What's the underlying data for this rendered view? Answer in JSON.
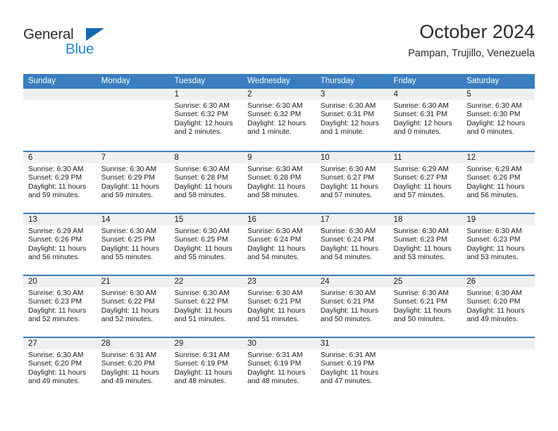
{
  "brand": {
    "line1": "General",
    "line2": "Blue",
    "triangle_icon": "triangle-icon",
    "color_dark": "#2b2b2b",
    "color_blue": "#1e87d6"
  },
  "header": {
    "title": "October 2024",
    "subtitle": "Pampan, Trujillo, Venezuela"
  },
  "colors": {
    "header_bar": "#3a7ebf",
    "daynum_strip": "#f0f0f0",
    "text": "#1a1a1a"
  },
  "weekdays": [
    "Sunday",
    "Monday",
    "Tuesday",
    "Wednesday",
    "Thursday",
    "Friday",
    "Saturday"
  ],
  "weeks": [
    [
      {
        "day": "",
        "lines": []
      },
      {
        "day": "",
        "lines": []
      },
      {
        "day": "1",
        "lines": [
          "Sunrise: 6:30 AM",
          "Sunset: 6:32 PM",
          "Daylight: 12 hours",
          "and 2 minutes."
        ]
      },
      {
        "day": "2",
        "lines": [
          "Sunrise: 6:30 AM",
          "Sunset: 6:32 PM",
          "Daylight: 12 hours",
          "and 1 minute."
        ]
      },
      {
        "day": "3",
        "lines": [
          "Sunrise: 6:30 AM",
          "Sunset: 6:31 PM",
          "Daylight: 12 hours",
          "and 1 minute."
        ]
      },
      {
        "day": "4",
        "lines": [
          "Sunrise: 6:30 AM",
          "Sunset: 6:31 PM",
          "Daylight: 12 hours",
          "and 0 minutes."
        ]
      },
      {
        "day": "5",
        "lines": [
          "Sunrise: 6:30 AM",
          "Sunset: 6:30 PM",
          "Daylight: 12 hours",
          "and 0 minutes."
        ]
      }
    ],
    [
      {
        "day": "6",
        "lines": [
          "Sunrise: 6:30 AM",
          "Sunset: 6:29 PM",
          "Daylight: 11 hours",
          "and 59 minutes."
        ]
      },
      {
        "day": "7",
        "lines": [
          "Sunrise: 6:30 AM",
          "Sunset: 6:29 PM",
          "Daylight: 11 hours",
          "and 59 minutes."
        ]
      },
      {
        "day": "8",
        "lines": [
          "Sunrise: 6:30 AM",
          "Sunset: 6:28 PM",
          "Daylight: 11 hours",
          "and 58 minutes."
        ]
      },
      {
        "day": "9",
        "lines": [
          "Sunrise: 6:30 AM",
          "Sunset: 6:28 PM",
          "Daylight: 11 hours",
          "and 58 minutes."
        ]
      },
      {
        "day": "10",
        "lines": [
          "Sunrise: 6:30 AM",
          "Sunset: 6:27 PM",
          "Daylight: 11 hours",
          "and 57 minutes."
        ]
      },
      {
        "day": "11",
        "lines": [
          "Sunrise: 6:29 AM",
          "Sunset: 6:27 PM",
          "Daylight: 11 hours",
          "and 57 minutes."
        ]
      },
      {
        "day": "12",
        "lines": [
          "Sunrise: 6:29 AM",
          "Sunset: 6:26 PM",
          "Daylight: 11 hours",
          "and 56 minutes."
        ]
      }
    ],
    [
      {
        "day": "13",
        "lines": [
          "Sunrise: 6:29 AM",
          "Sunset: 6:26 PM",
          "Daylight: 11 hours",
          "and 56 minutes."
        ]
      },
      {
        "day": "14",
        "lines": [
          "Sunrise: 6:30 AM",
          "Sunset: 6:25 PM",
          "Daylight: 11 hours",
          "and 55 minutes."
        ]
      },
      {
        "day": "15",
        "lines": [
          "Sunrise: 6:30 AM",
          "Sunset: 6:25 PM",
          "Daylight: 11 hours",
          "and 55 minutes."
        ]
      },
      {
        "day": "16",
        "lines": [
          "Sunrise: 6:30 AM",
          "Sunset: 6:24 PM",
          "Daylight: 11 hours",
          "and 54 minutes."
        ]
      },
      {
        "day": "17",
        "lines": [
          "Sunrise: 6:30 AM",
          "Sunset: 6:24 PM",
          "Daylight: 11 hours",
          "and 54 minutes."
        ]
      },
      {
        "day": "18",
        "lines": [
          "Sunrise: 6:30 AM",
          "Sunset: 6:23 PM",
          "Daylight: 11 hours",
          "and 53 minutes."
        ]
      },
      {
        "day": "19",
        "lines": [
          "Sunrise: 6:30 AM",
          "Sunset: 6:23 PM",
          "Daylight: 11 hours",
          "and 53 minutes."
        ]
      }
    ],
    [
      {
        "day": "20",
        "lines": [
          "Sunrise: 6:30 AM",
          "Sunset: 6:23 PM",
          "Daylight: 11 hours",
          "and 52 minutes."
        ]
      },
      {
        "day": "21",
        "lines": [
          "Sunrise: 6:30 AM",
          "Sunset: 6:22 PM",
          "Daylight: 11 hours",
          "and 52 minutes."
        ]
      },
      {
        "day": "22",
        "lines": [
          "Sunrise: 6:30 AM",
          "Sunset: 6:22 PM",
          "Daylight: 11 hours",
          "and 51 minutes."
        ]
      },
      {
        "day": "23",
        "lines": [
          "Sunrise: 6:30 AM",
          "Sunset: 6:21 PM",
          "Daylight: 11 hours",
          "and 51 minutes."
        ]
      },
      {
        "day": "24",
        "lines": [
          "Sunrise: 6:30 AM",
          "Sunset: 6:21 PM",
          "Daylight: 11 hours",
          "and 50 minutes."
        ]
      },
      {
        "day": "25",
        "lines": [
          "Sunrise: 6:30 AM",
          "Sunset: 6:21 PM",
          "Daylight: 11 hours",
          "and 50 minutes."
        ]
      },
      {
        "day": "26",
        "lines": [
          "Sunrise: 6:30 AM",
          "Sunset: 6:20 PM",
          "Daylight: 11 hours",
          "and 49 minutes."
        ]
      }
    ],
    [
      {
        "day": "27",
        "lines": [
          "Sunrise: 6:30 AM",
          "Sunset: 6:20 PM",
          "Daylight: 11 hours",
          "and 49 minutes."
        ]
      },
      {
        "day": "28",
        "lines": [
          "Sunrise: 6:31 AM",
          "Sunset: 6:20 PM",
          "Daylight: 11 hours",
          "and 49 minutes."
        ]
      },
      {
        "day": "29",
        "lines": [
          "Sunrise: 6:31 AM",
          "Sunset: 6:19 PM",
          "Daylight: 11 hours",
          "and 48 minutes."
        ]
      },
      {
        "day": "30",
        "lines": [
          "Sunrise: 6:31 AM",
          "Sunset: 6:19 PM",
          "Daylight: 11 hours",
          "and 48 minutes."
        ]
      },
      {
        "day": "31",
        "lines": [
          "Sunrise: 6:31 AM",
          "Sunset: 6:19 PM",
          "Daylight: 11 hours",
          "and 47 minutes."
        ]
      },
      {
        "day": "",
        "lines": []
      },
      {
        "day": "",
        "lines": []
      }
    ]
  ]
}
